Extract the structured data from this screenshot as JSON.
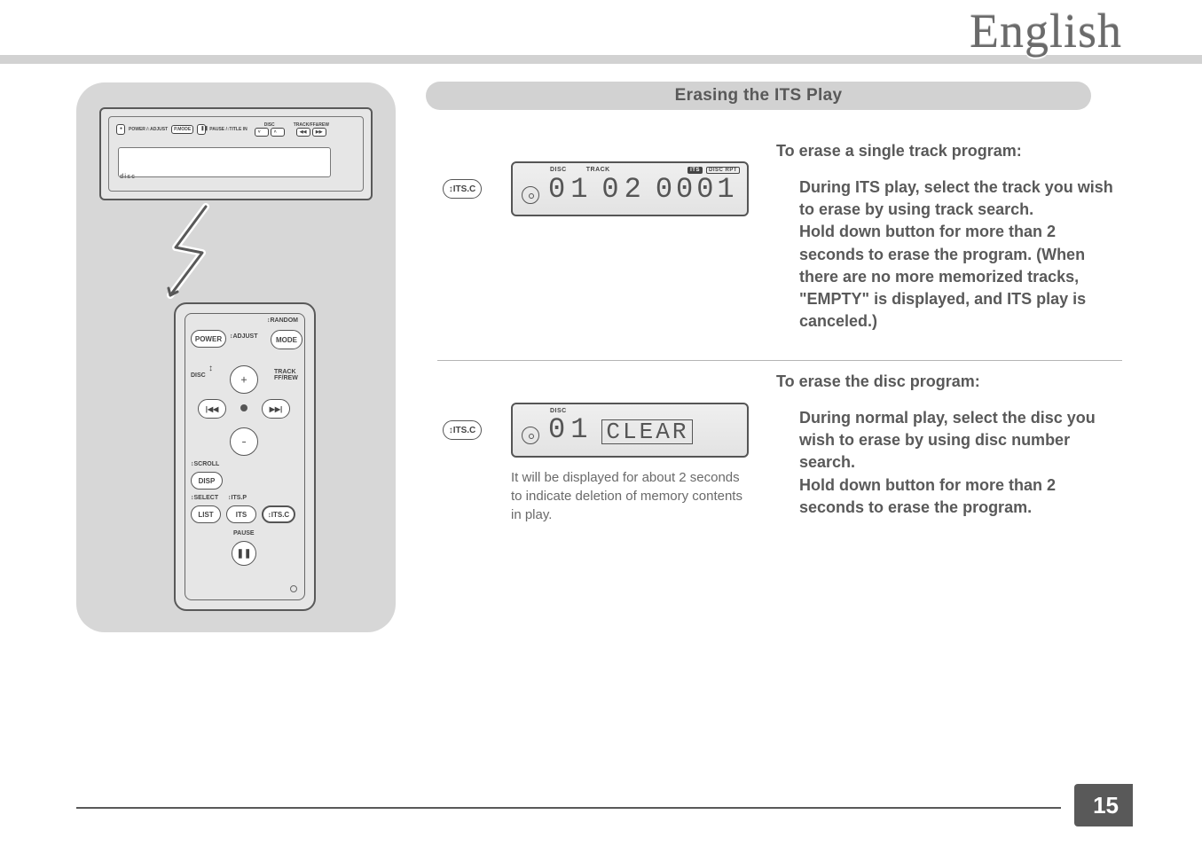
{
  "language_label": "English",
  "section_title": "Erasing the ITS Play",
  "page_number": "15",
  "its_button_label": "↕ITS.C",
  "unit": {
    "btn_power": "POWER /↕ADJUST",
    "btn_pmode": "P.MODE",
    "btn_pause": "PAUSE /↕TITLE IN",
    "label_disc": "DISC",
    "label_track": "TRACK/FF&REW",
    "cd_text": "disc"
  },
  "remote": {
    "power": "POWER",
    "adjust": "↕ADJUST",
    "random": "↕RANDOM",
    "mode": "MODE",
    "disc": "DISC",
    "track": "TRACK FF/REW",
    "scroll": "↕SCROLL",
    "disp": "DISP",
    "select": "↕SELECT",
    "itsp": "↕ITS.P",
    "list": "LIST",
    "its": "ITS",
    "itsc": "↕ITS.C",
    "pause": "PAUSE",
    "prev": "|◀◀",
    "next": "▶▶|",
    "plus": "＋",
    "minus": "−",
    "pauseicon": "❚❚"
  },
  "lcd1": {
    "labels": {
      "disc": "DISC",
      "track": "TRACK",
      "its": "ITS",
      "discrpt": "DISC RPT"
    },
    "disc_num": "01",
    "track_num": "02",
    "value": "0001"
  },
  "lcd2": {
    "labels": {
      "disc": "DISC"
    },
    "disc_num": "01",
    "value": "CLEAR"
  },
  "caption_lcd2": "It will be displayed for about 2 seconds to indicate deletion of memory contents in play.",
  "block1": {
    "heading": "To erase a single track program:",
    "body": "During ITS play, select the track you wish to erase by using track search.\nHold down button for more than 2 seconds to erase the program. (When there are no more memo­rized tracks, \"EMPTY\" is displayed, and ITS play is canceled.)"
  },
  "block2": {
    "heading": "To erase the disc program:",
    "body": "During normal play, select the disc you wish to erase by using disc number search.\nHold down button for more than 2 seconds to erase the program."
  }
}
